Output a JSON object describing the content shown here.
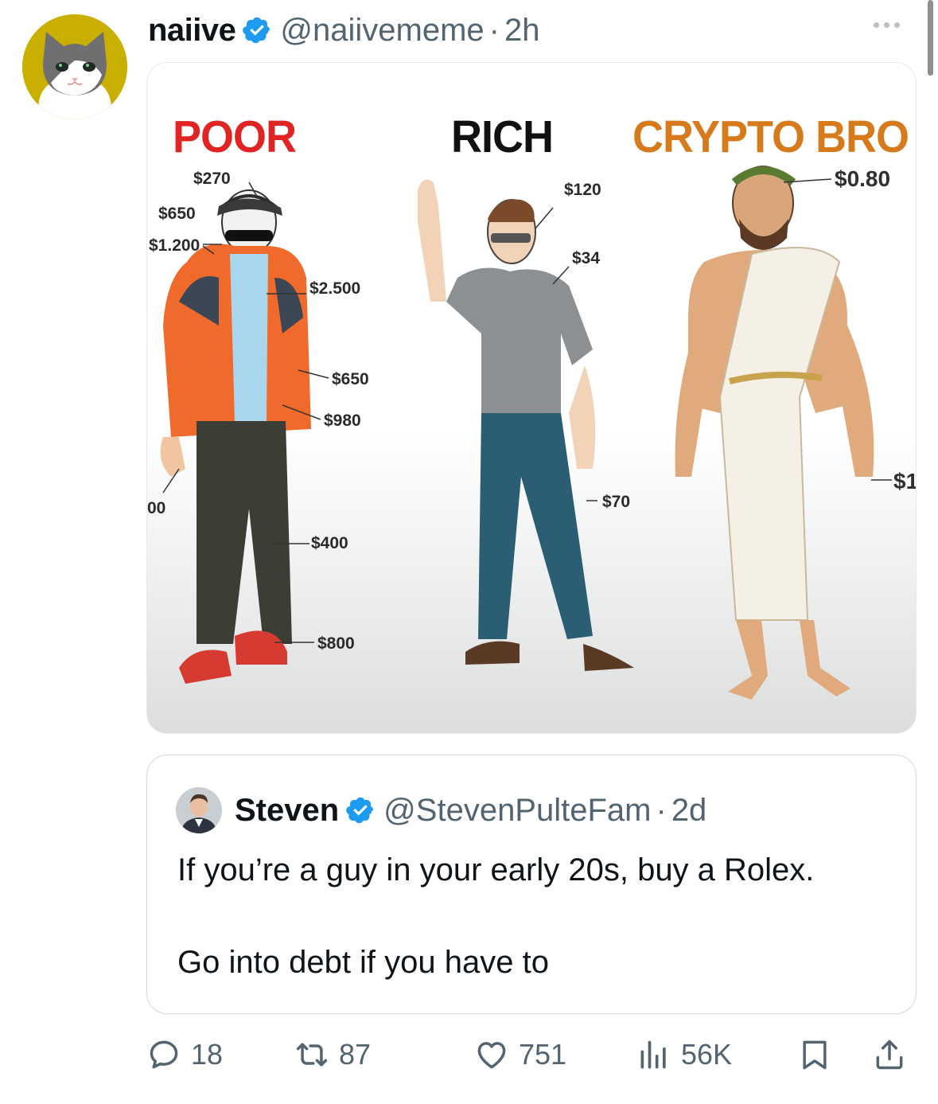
{
  "tweet": {
    "author_name": "naiive",
    "handle": "@naiivememe",
    "separator": "·",
    "time": "2h",
    "media": {
      "columns": [
        {
          "title": "POOR",
          "color": "#e02424"
        },
        {
          "title": "RICH",
          "color": "#111111"
        },
        {
          "title": "CRYPTO BRO",
          "color": "#d77a1c"
        }
      ],
      "poor_prices": {
        "cap": "$270",
        "headphones": "$650",
        "glasses": "$1.200",
        "chain": "$2.500",
        "jacket": "$650",
        "pocket": "$980",
        "watch": "00",
        "pants": "$400",
        "shoes": "$800"
      },
      "rich_prices": {
        "glasses": "$120",
        "shirt": "$34",
        "jeans": "$70"
      },
      "crypto_prices": {
        "wreath": "$0.80",
        "robe": "$1"
      }
    }
  },
  "quote": {
    "author_name": "Steven",
    "handle": "@StevenPulteFam",
    "separator": "·",
    "time": "2d",
    "line1": "If you’re a guy in your early 20s, buy a Rolex.",
    "line2": "Go into debt if you have to"
  },
  "actions": {
    "replies": "18",
    "retweets": "87",
    "likes": "751",
    "views": "56K"
  },
  "icons": {
    "verified": "verified-badge-icon",
    "more": "more-dots-icon",
    "reply": "reply-icon",
    "retweet": "retweet-icon",
    "like": "heart-icon",
    "views": "views-icon",
    "bookmark": "bookmark-icon",
    "share": "share-icon"
  },
  "colors": {
    "verified_blue": "#1d9bf0",
    "secondary_text": "#536471",
    "avatar_bg": "#c9b000"
  }
}
